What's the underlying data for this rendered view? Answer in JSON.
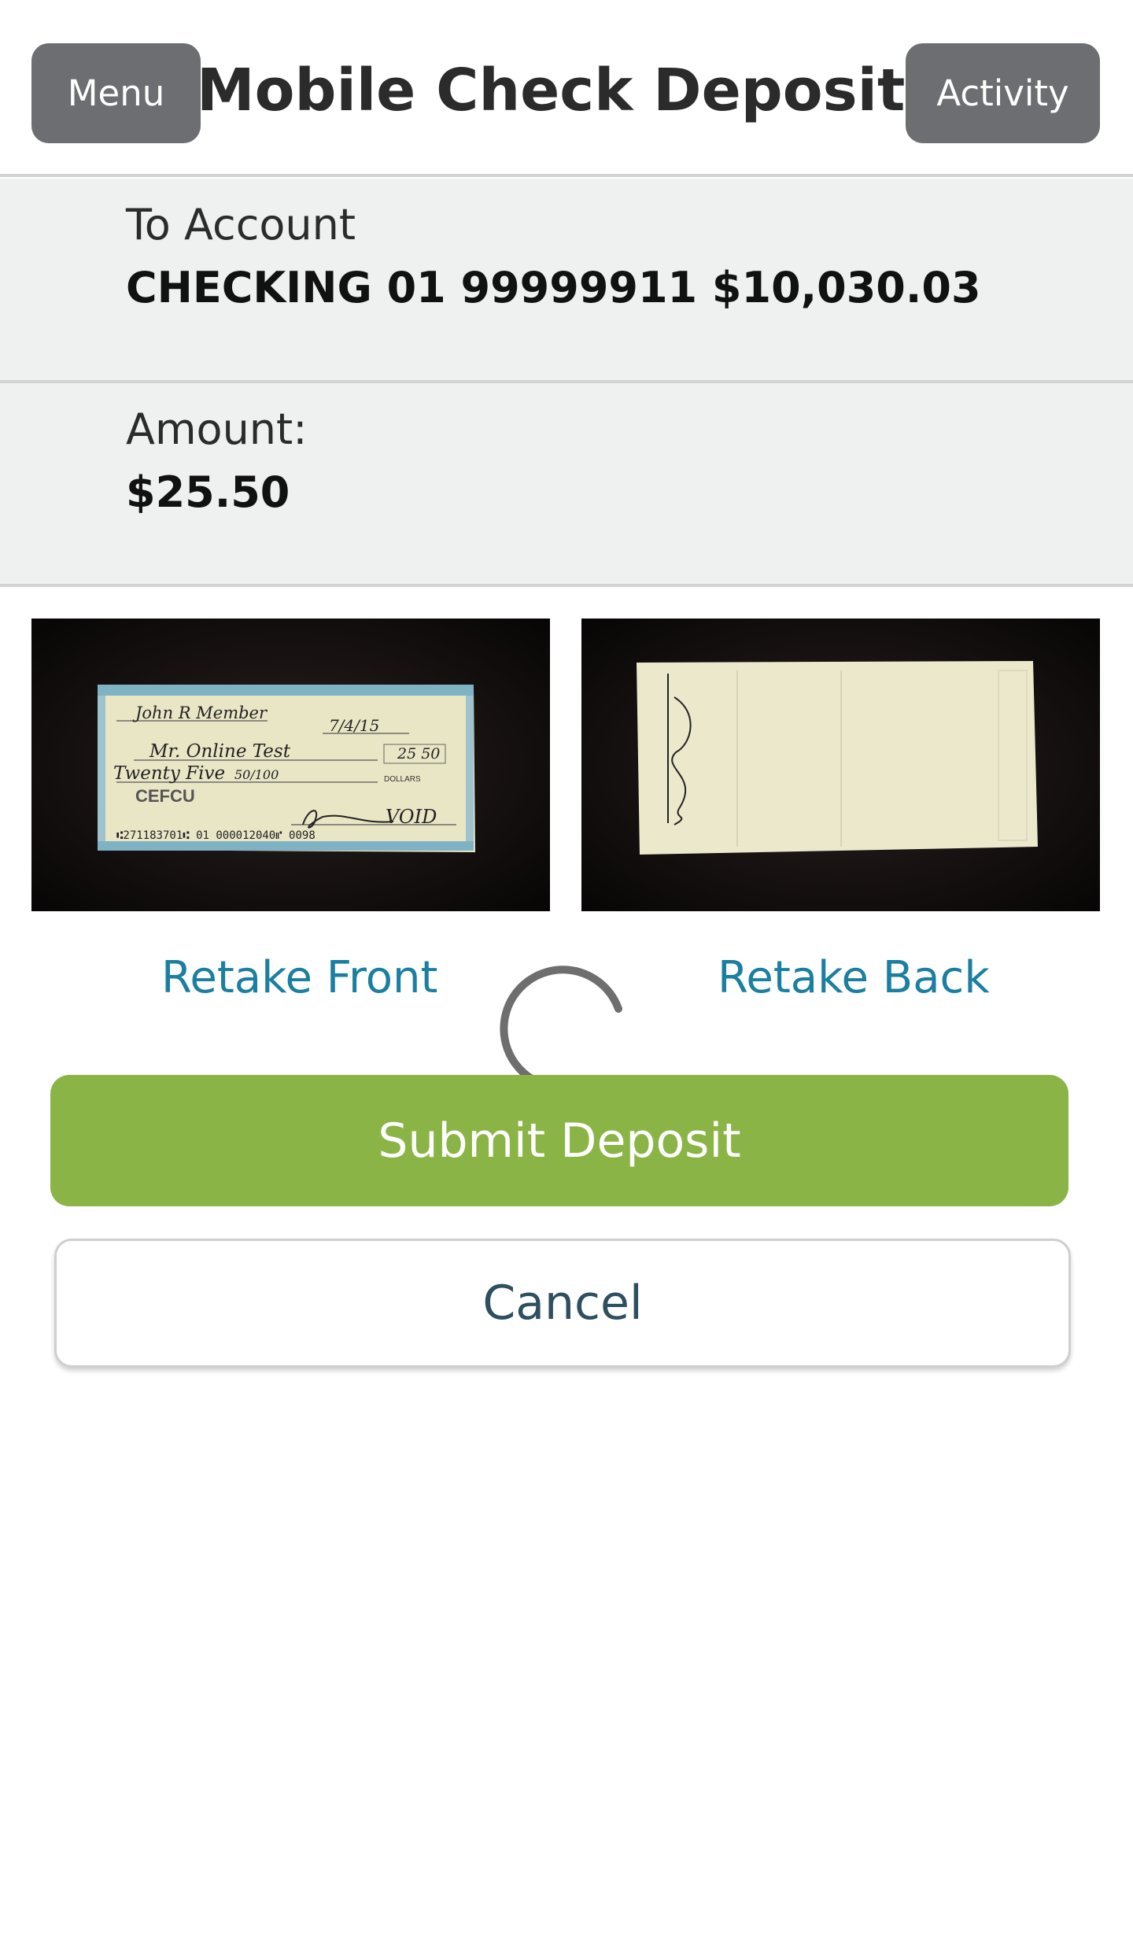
{
  "header": {
    "menu_label": "Menu",
    "title": "Mobile Check Deposit",
    "activity_label": "Activity"
  },
  "account": {
    "label": "To Account",
    "value": "CHECKING 01 99999911 $10,030.03"
  },
  "amount": {
    "label": "Amount:",
    "value": "$25.50"
  },
  "check_front": {
    "name": "John R Member",
    "date": "7/4/15",
    "payee": "Mr. Online Test",
    "amount": "25 50",
    "written_amount": "Twenty Five",
    "written_fraction": "50/100",
    "bank": "CEFCU",
    "dollars_label": "DOLLARS",
    "void_text": "VOID",
    "micr": "⑆271183701⑆ 01 000012040⑈ 0098"
  },
  "actions": {
    "retake_front": "Retake Front",
    "retake_back": "Retake Back",
    "submit": "Submit Deposit",
    "cancel": "Cancel"
  },
  "colors": {
    "header_button": "#6d6e71",
    "panel_bg": "#eff0f0",
    "link": "#1a7fa0",
    "submit": "#8ab445",
    "cancel_text": "#2e4f5e"
  },
  "icons": {
    "spinner": "loading-spinner-icon"
  }
}
